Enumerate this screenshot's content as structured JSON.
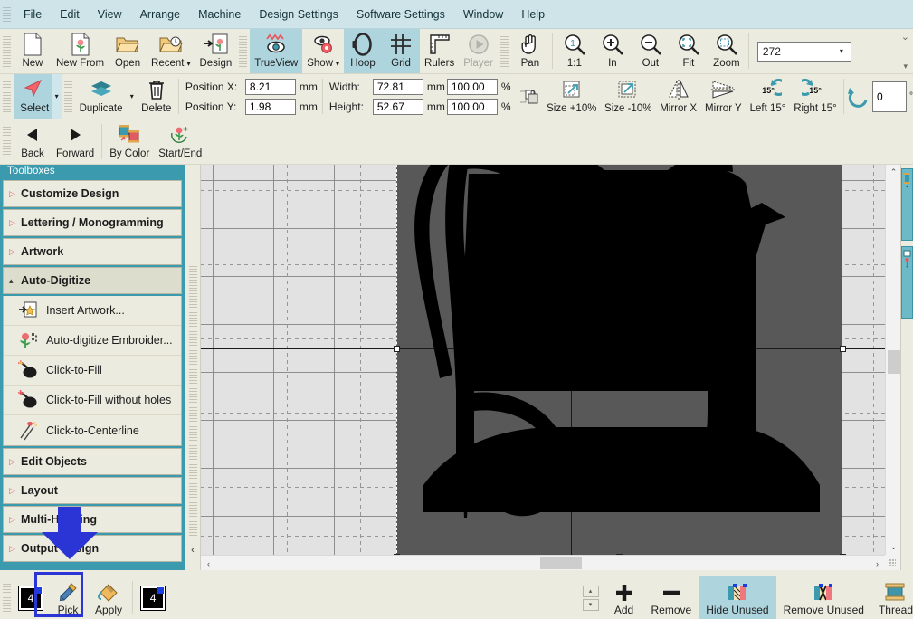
{
  "menubar": {
    "items": [
      {
        "label": "File"
      },
      {
        "label": "Edit"
      },
      {
        "label": "View"
      },
      {
        "label": "Arrange"
      },
      {
        "label": "Machine"
      },
      {
        "label": "Design Settings"
      },
      {
        "label": "Software Settings"
      },
      {
        "label": "Window"
      },
      {
        "label": "Help"
      }
    ]
  },
  "ribbon": {
    "row1": {
      "file_group": [
        {
          "label": "New",
          "icon": "new-page-icon"
        },
        {
          "label": "New From",
          "icon": "new-from-icon"
        },
        {
          "label": "Open",
          "icon": "open-folder-icon"
        },
        {
          "label": "Recent",
          "icon": "recent-folder-icon",
          "caret": "▾"
        },
        {
          "label": "Design",
          "icon": "design-import-icon"
        }
      ],
      "view_group": [
        {
          "label": "TrueView",
          "icon": "trueview-eye-icon",
          "state": "active"
        },
        {
          "label": "Show",
          "icon": "show-eye-gear-icon",
          "caret": "▾"
        },
        {
          "label": "Hoop",
          "icon": "hoop-icon",
          "state": "active"
        },
        {
          "label": "Grid",
          "icon": "grid-icon",
          "state": "active"
        },
        {
          "label": "Rulers",
          "icon": "ruler-icon"
        },
        {
          "label": "Player",
          "icon": "player-icon",
          "state": "disabled"
        }
      ],
      "zoom_group": [
        {
          "label": "Pan",
          "icon": "pan-hand-icon"
        },
        {
          "label": "1:1",
          "icon": "zoom-one-to-one-icon"
        },
        {
          "label": "In",
          "icon": "zoom-in-icon"
        },
        {
          "label": "Out",
          "icon": "zoom-out-icon"
        },
        {
          "label": "Fit",
          "icon": "zoom-fit-icon"
        },
        {
          "label": "Zoom",
          "icon": "zoom-marquee-icon"
        }
      ],
      "zoom_level": {
        "value": "272",
        "arrow": "▾"
      }
    },
    "row2": {
      "select_label": "Select",
      "select_icon": "arrow-cursor-icon",
      "duplicate_label": "Duplicate",
      "duplicate_icon": "duplicate-layers-icon",
      "delete_label": "Delete",
      "delete_icon": "trash-icon",
      "position_x_label": "Position X:",
      "position_x_value": "8.21",
      "position_y_label": "Position Y:",
      "position_y_value": "1.98",
      "mm": "mm",
      "width_label": "Width:",
      "width_value": "72.81",
      "height_label": "Height:",
      "height_value": "52.67",
      "width_pct": "100.00",
      "height_pct": "100.00",
      "pct": "%",
      "lock_icon": "aspect-lock-icon",
      "transform_buttons": [
        {
          "label": "Size +10%",
          "icon": "size-increase-icon"
        },
        {
          "label": "Size -10%",
          "icon": "size-decrease-icon"
        },
        {
          "label": "Mirror X",
          "icon": "mirror-x-icon"
        },
        {
          "label": "Mirror Y",
          "icon": "mirror-y-icon"
        },
        {
          "label": "Left 15°",
          "icon": "rotate-left-icon"
        },
        {
          "label": "Right 15°",
          "icon": "rotate-right-icon"
        }
      ],
      "rotate_icon": "rotate-free-icon",
      "angle_value": "0",
      "degree": "°"
    },
    "row3": [
      {
        "label": "Back",
        "icon": "back-triangle-icon"
      },
      {
        "label": "Forward",
        "icon": "forward-triangle-icon"
      },
      {
        "label": "By Color",
        "icon": "by-color-spools-icon"
      },
      {
        "label": "Start/End",
        "icon": "start-end-icon"
      }
    ]
  },
  "toolbox": {
    "title": "Toolboxes",
    "groups": [
      {
        "label": "Customize Design",
        "expanded": false
      },
      {
        "label": "Lettering / Monogramming",
        "expanded": false
      },
      {
        "label": "Artwork",
        "expanded": false
      },
      {
        "label": "Auto-Digitize",
        "expanded": true,
        "items": [
          {
            "label": "Insert Artwork...",
            "icon": "insert-artwork-icon"
          },
          {
            "label": "Auto-digitize Embroider...",
            "icon": "auto-digitize-icon"
          },
          {
            "label": "Click-to-Fill",
            "icon": "click-to-fill-icon"
          },
          {
            "label": "Click-to-Fill without holes",
            "icon": "click-to-fill-noholes-icon"
          },
          {
            "label": "Click-to-Centerline",
            "icon": "click-to-centerline-icon"
          }
        ]
      },
      {
        "label": "Edit Objects",
        "expanded": false
      },
      {
        "label": "Layout",
        "expanded": false
      },
      {
        "label": "Multi-Hooping",
        "expanded": false
      },
      {
        "label": "Output Design",
        "expanded": false
      }
    ],
    "collapse_icon": "chevron-left-icon"
  },
  "canvas": {
    "design_name": "sewing-machine-silhouette",
    "artwork_color": "#000000",
    "hoop_fill": "#585858",
    "background": "#e2e2e2",
    "selection_handles": 8
  },
  "scrollbars": {
    "up_arrow": "⌃",
    "down_arrow": "⌄",
    "left_arrow": "‹",
    "right_arrow": "›"
  },
  "dock": {
    "tabs": [
      {
        "name": "thread-palette-tab"
      },
      {
        "name": "design-objects-tab"
      }
    ]
  },
  "bottombar": {
    "current_color_number": "4",
    "pick_label": "Pick",
    "pick_icon": "eyedropper-icon",
    "apply_label": "Apply",
    "apply_icon": "paint-bucket-icon",
    "target_color_number": "4",
    "spinner_up": "▴",
    "spinner_down": "▾",
    "buttons": [
      {
        "label": "Add",
        "icon": "plus-icon",
        "state": ""
      },
      {
        "label": "Remove",
        "icon": "minus-icon",
        "state": ""
      },
      {
        "label": "Hide Unused",
        "icon": "hide-unused-icon",
        "state": "selected"
      },
      {
        "label": "Remove Unused",
        "icon": "remove-unused-icon",
        "state": ""
      },
      {
        "label": "Thread",
        "icon": "thread-spool-icon",
        "state": ""
      }
    ]
  },
  "annotations": {
    "arrow_color": "#2b35d6",
    "highlight_color": "#2b35d6",
    "highlight_target": "Pick"
  }
}
